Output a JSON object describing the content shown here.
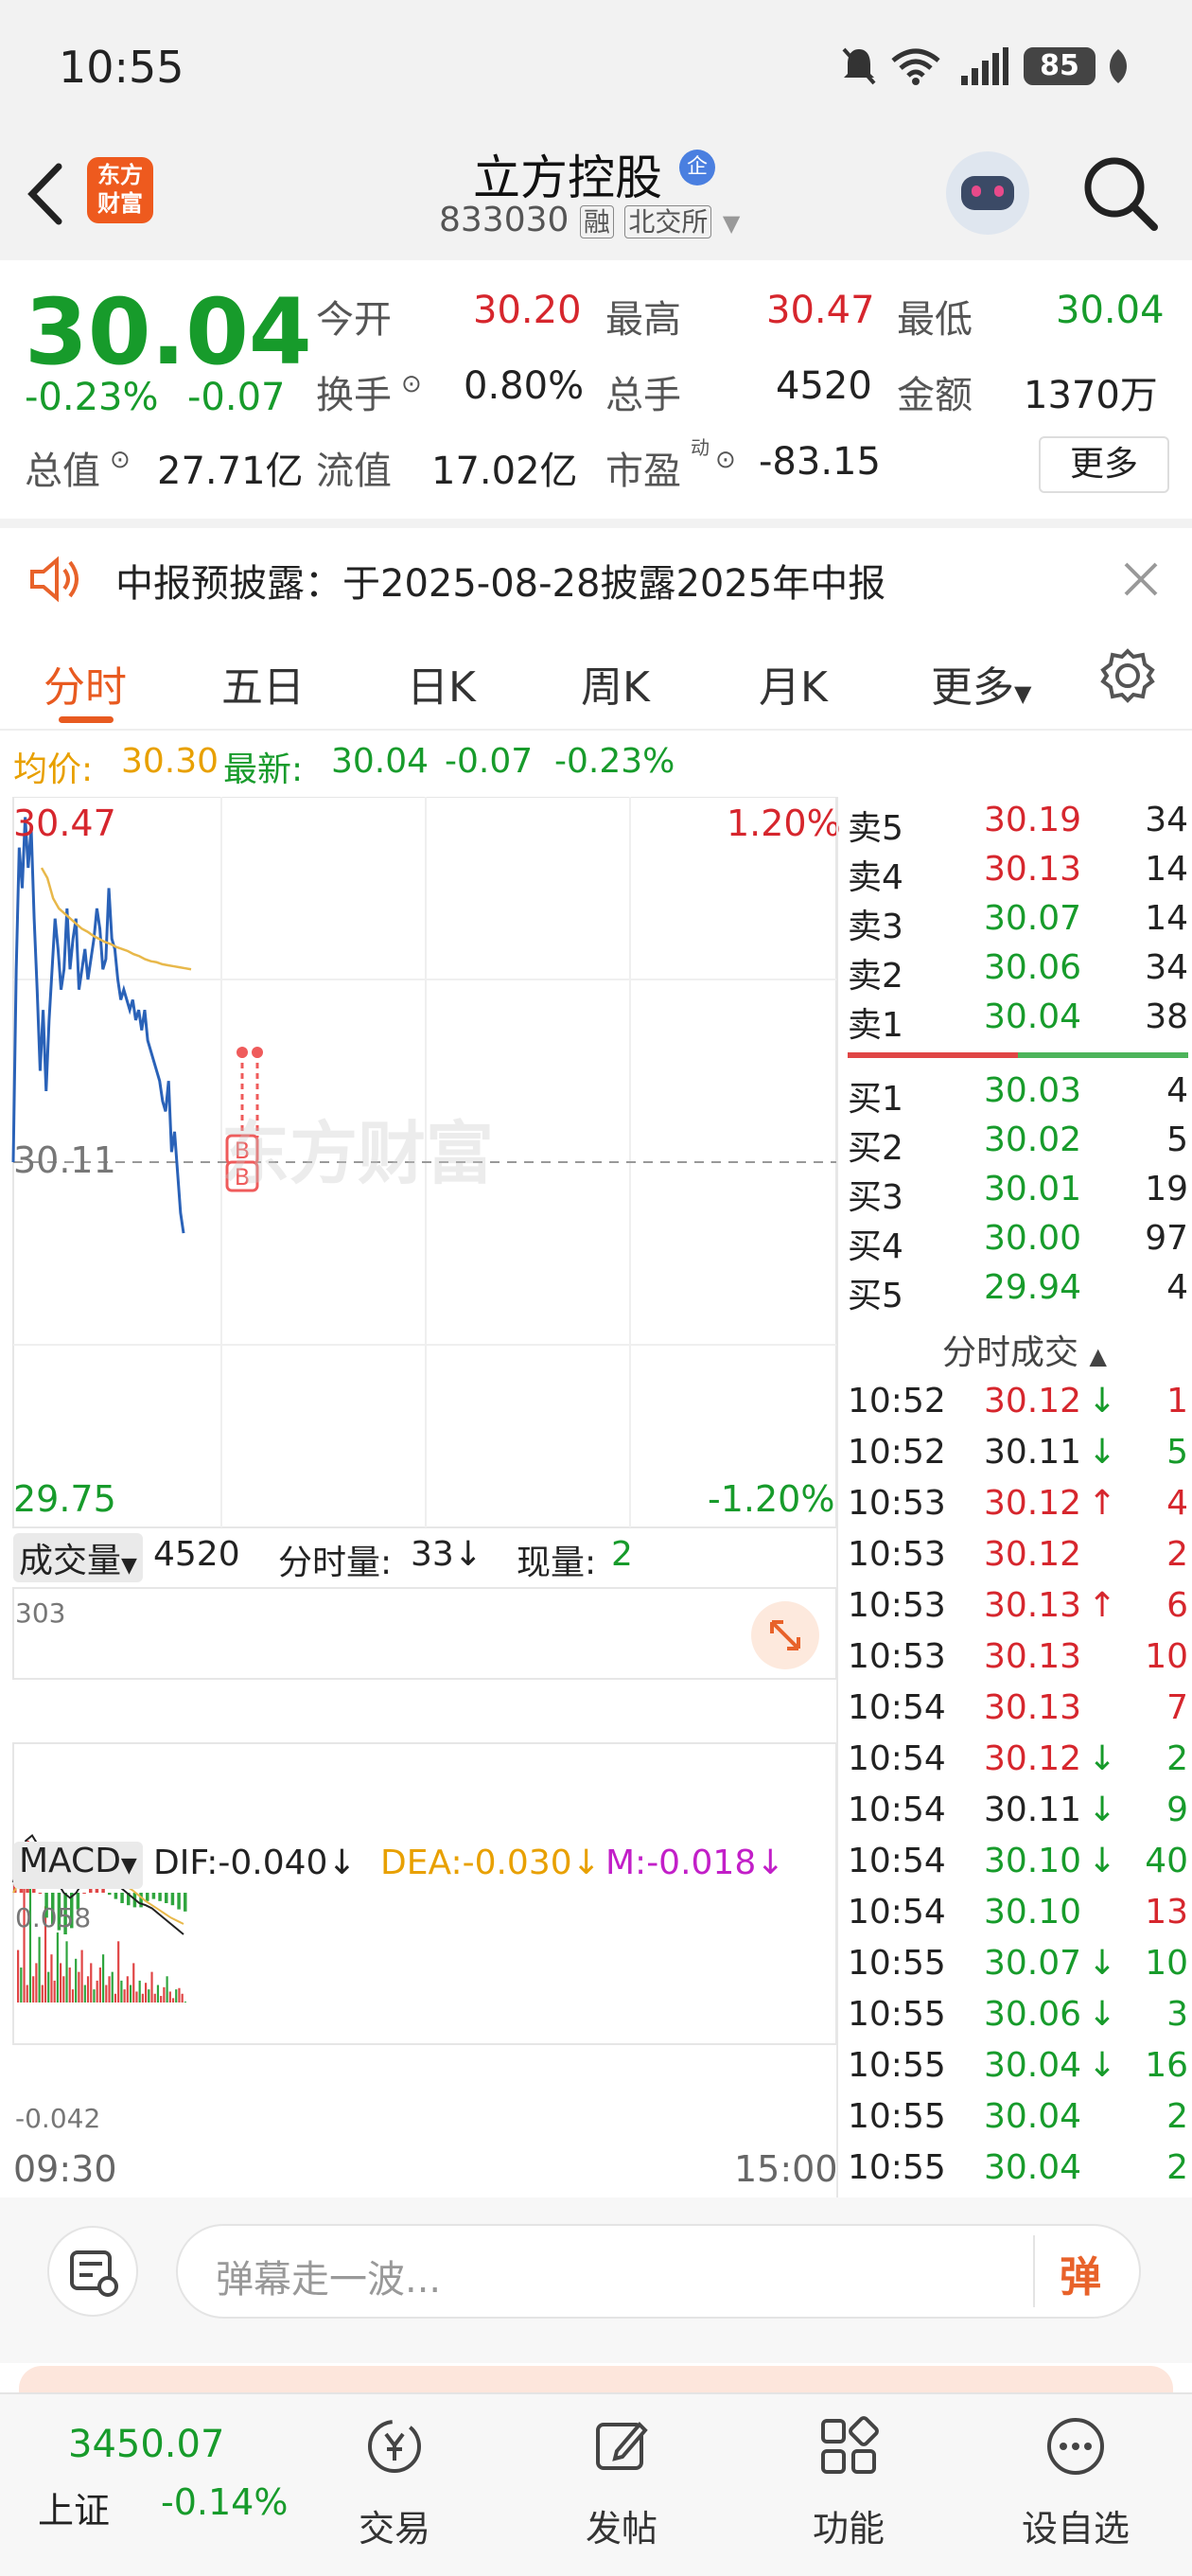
{
  "status": {
    "time": "10:55",
    "battery": "85"
  },
  "header": {
    "logo_text": "东方财富",
    "stock_name": "立方控股",
    "badge": "企",
    "code": "833030",
    "margin_tag": "融",
    "exchange": "北交所"
  },
  "quote": {
    "price": "30.04",
    "change_pct": "-0.23%",
    "change": "-0.07",
    "open_label": "今开",
    "open": "30.20",
    "high_label": "最高",
    "high": "30.47",
    "low_label": "最低",
    "low": "30.04",
    "turnover_label": "换手",
    "turnover": "0.80%",
    "volume_label": "总手",
    "volume": "4520",
    "amount_label": "金额",
    "amount": "1370万",
    "mktcap_label": "总值",
    "mktcap": "27.71亿",
    "float_label": "流值",
    "float_cap": "17.02亿",
    "pe_label": "市盈",
    "pe_sup": "动",
    "pe": "-83.15",
    "more_btn": "更多"
  },
  "notice": {
    "text": "中报预披露：于2025-08-28披露2025年中报"
  },
  "tabs": [
    "分时",
    "五日",
    "日K",
    "周K",
    "月K",
    "更多"
  ],
  "avg_line": {
    "avg_label": "均价:",
    "avg_value": "30.30",
    "latest_label": "最新:",
    "latest_value": "30.04",
    "latest_change": "-0.07",
    "latest_pct": "-0.23%"
  },
  "chart_labels": {
    "top_price": "30.47",
    "top_pct": "1.20%",
    "mid_price": "30.11",
    "bottom_price": "29.75",
    "bottom_pct": "-1.20%",
    "watermark": "东方财富",
    "vol_label": "成交量",
    "vol_total": "4520",
    "tick_vol_label": "分时量:",
    "tick_vol": "33↓",
    "cur_vol_label": "现量:",
    "cur_vol": "2",
    "vol_max": "303",
    "macd_label": "MACD",
    "dif": "DIF:-0.040↓",
    "dea": "DEA:-0.030↓",
    "m": "M:-0.018↓",
    "macd_top": "0.058",
    "macd_bottom": "-0.042",
    "time_start": "09:30",
    "time_end": "15:00"
  },
  "chart_data": {
    "type": "line",
    "ylim": [
      29.75,
      30.47
    ],
    "x": [
      "09:30",
      "15:00"
    ],
    "series": [
      {
        "values": [
          30.11,
          30.3,
          30.42,
          30.38,
          30.45,
          30.4,
          30.44,
          30.35,
          30.28,
          30.2,
          30.26,
          30.18,
          30.25,
          30.3,
          30.35,
          30.32,
          30.28,
          30.3,
          30.36,
          30.3,
          30.33,
          30.35,
          30.28,
          30.3,
          30.32,
          30.29,
          30.31,
          30.33,
          30.36,
          30.34,
          30.3,
          30.31,
          30.38,
          30.33,
          30.32,
          30.29,
          30.27,
          30.28,
          30.27,
          30.26,
          30.27,
          30.25,
          30.26,
          30.24,
          30.26,
          30.23,
          30.22,
          30.21,
          30.2,
          30.19,
          30.17,
          30.16,
          30.19,
          30.12,
          30.14,
          30.1,
          30.06,
          30.04
        ]
      },
      {
        "values": [
          30.4,
          30.39,
          30.37,
          30.36,
          30.355,
          30.35,
          30.345,
          30.34,
          30.337,
          30.333,
          30.33,
          30.327,
          30.325,
          30.322,
          30.32,
          30.318,
          30.315,
          30.313,
          30.31,
          30.308,
          30.307,
          30.305,
          30.304,
          30.303,
          30.302,
          30.301,
          30.3
        ]
      }
    ],
    "volume": [
      120,
      80,
      260,
      40,
      303,
      60,
      90,
      150,
      40,
      220,
      70,
      110,
      50,
      160,
      90,
      60,
      140,
      80,
      30,
      100,
      70,
      120,
      40,
      60,
      90,
      30,
      50,
      80,
      110,
      40,
      60,
      70,
      20,
      140,
      50,
      30,
      60,
      40,
      90,
      25,
      50,
      20,
      45,
      30,
      70,
      20,
      40,
      15,
      35,
      60,
      25,
      10,
      30,
      33,
      20,
      2
    ],
    "macd_dif": [
      0.01,
      0.03,
      0.05,
      0.055,
      0.045,
      0.03,
      0.02,
      0.01,
      0.0,
      -0.005,
      0.0,
      0.01,
      0.02,
      0.025,
      0.02,
      0.015,
      0.01,
      0.005,
      0.0,
      -0.005,
      -0.01,
      -0.012,
      -0.015,
      -0.02,
      -0.025,
      -0.03,
      -0.035,
      -0.04
    ],
    "macd_dea": [
      0.0,
      0.01,
      0.025,
      0.04,
      0.045,
      0.042,
      0.035,
      0.028,
      0.02,
      0.012,
      0.008,
      0.01,
      0.014,
      0.018,
      0.018,
      0.016,
      0.013,
      0.01,
      0.006,
      0.002,
      -0.003,
      -0.008,
      -0.012,
      -0.016,
      -0.02,
      -0.024,
      -0.027,
      -0.03
    ],
    "macd_m": [
      0.02,
      0.04,
      0.05,
      0.03,
      0.0,
      -0.024,
      -0.03,
      -0.036,
      -0.04,
      -0.034,
      -0.016,
      0.0,
      0.012,
      0.014,
      0.004,
      -0.002,
      -0.006,
      -0.01,
      -0.012,
      -0.014,
      -0.014,
      -0.008,
      -0.006,
      -0.008,
      -0.01,
      -0.012,
      -0.016,
      -0.018
    ]
  },
  "orderbook": {
    "asks": [
      {
        "label": "卖5",
        "price": "30.19",
        "qty": "34"
      },
      {
        "label": "卖4",
        "price": "30.13",
        "qty": "14"
      },
      {
        "label": "卖3",
        "price": "30.07",
        "qty": "14"
      },
      {
        "label": "卖2",
        "price": "30.06",
        "qty": "34"
      },
      {
        "label": "卖1",
        "price": "30.04",
        "qty": "38"
      }
    ],
    "bids": [
      {
        "label": "买1",
        "price": "30.03",
        "qty": "4"
      },
      {
        "label": "买2",
        "price": "30.02",
        "qty": "5"
      },
      {
        "label": "买3",
        "price": "30.01",
        "qty": "19"
      },
      {
        "label": "买4",
        "price": "30.00",
        "qty": "97"
      },
      {
        "label": "买5",
        "price": "29.94",
        "qty": "4"
      }
    ],
    "ticks_title": "分时成交"
  },
  "ticks": [
    {
      "time": "10:52",
      "price": "30.12",
      "dir": "↓",
      "qty": "1",
      "pc": "red",
      "qc": "red"
    },
    {
      "time": "10:52",
      "price": "30.11",
      "dir": "↓",
      "qty": "5",
      "pc": "dark",
      "qc": "green"
    },
    {
      "time": "10:53",
      "price": "30.12",
      "dir": "↑",
      "qty": "4",
      "pc": "red",
      "qc": "red"
    },
    {
      "time": "10:53",
      "price": "30.12",
      "dir": "",
      "qty": "2",
      "pc": "red",
      "qc": "red"
    },
    {
      "time": "10:53",
      "price": "30.13",
      "dir": "↑",
      "qty": "6",
      "pc": "red",
      "qc": "red"
    },
    {
      "time": "10:53",
      "price": "30.13",
      "dir": "",
      "qty": "10",
      "pc": "red",
      "qc": "red"
    },
    {
      "time": "10:54",
      "price": "30.13",
      "dir": "",
      "qty": "7",
      "pc": "red",
      "qc": "red"
    },
    {
      "time": "10:54",
      "price": "30.12",
      "dir": "↓",
      "qty": "2",
      "pc": "red",
      "qc": "green"
    },
    {
      "time": "10:54",
      "price": "30.11",
      "dir": "↓",
      "qty": "9",
      "pc": "dark",
      "qc": "green"
    },
    {
      "time": "10:54",
      "price": "30.10",
      "dir": "↓",
      "qty": "40",
      "pc": "green",
      "qc": "green"
    },
    {
      "time": "10:54",
      "price": "30.10",
      "dir": "",
      "qty": "13",
      "pc": "green",
      "qc": "red"
    },
    {
      "time": "10:55",
      "price": "30.07",
      "dir": "↓",
      "qty": "10",
      "pc": "green",
      "qc": "green"
    },
    {
      "time": "10:55",
      "price": "30.06",
      "dir": "↓",
      "qty": "3",
      "pc": "green",
      "qc": "green"
    },
    {
      "time": "10:55",
      "price": "30.04",
      "dir": "↓",
      "qty": "16",
      "pc": "green",
      "qc": "green"
    },
    {
      "time": "10:55",
      "price": "30.04",
      "dir": "",
      "qty": "2",
      "pc": "green",
      "qc": "green"
    },
    {
      "time": "10:55",
      "price": "30.04",
      "dir": "",
      "qty": "2",
      "pc": "green",
      "qc": "green"
    }
  ],
  "comment": {
    "placeholder": "弹幕走一波...",
    "send": "弹"
  },
  "nav": {
    "index_value": "3450.07",
    "index_name": "上证",
    "index_pct": "-0.14%",
    "items": [
      "交易",
      "发帖",
      "功能",
      "设自选"
    ]
  }
}
